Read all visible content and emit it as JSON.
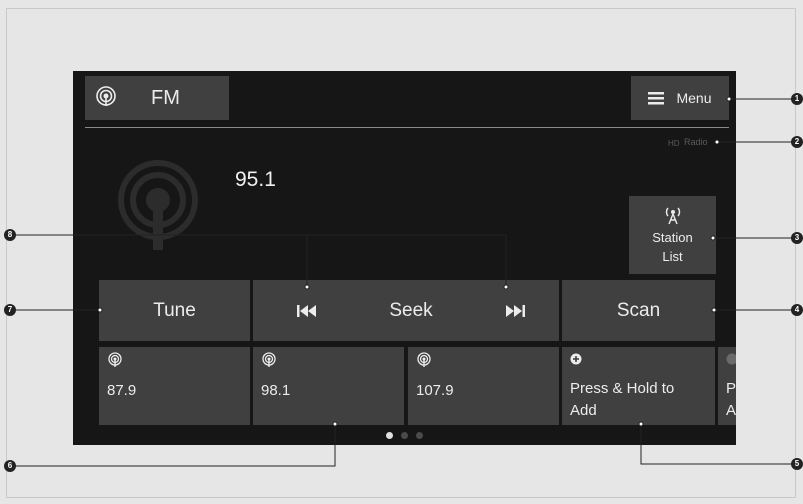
{
  "source": {
    "label": "FM",
    "icon": "radio-icon"
  },
  "menu": {
    "label": "Menu",
    "icon": "hamburger-icon"
  },
  "hd_radio": {
    "label": "Radio"
  },
  "frequency": "95.1",
  "station_list": {
    "label_line1": "Station",
    "label_line2": "List",
    "icon": "antenna-icon"
  },
  "controls": {
    "tune": "Tune",
    "seek": "Seek",
    "scan": "Scan"
  },
  "presets": [
    {
      "label": "87.9"
    },
    {
      "label": "98.1"
    },
    {
      "label": "107.9"
    },
    {
      "label_line1": "Press & Hold to",
      "label_line2": "Add"
    },
    {
      "label_line1": "P",
      "label_line2": "A"
    }
  ],
  "page_indicator": {
    "count": 3,
    "active": 1
  },
  "callouts": [
    "1",
    "2",
    "3",
    "4",
    "5",
    "6",
    "7",
    "8"
  ],
  "colors": {
    "screen_bg": "#161616",
    "button_bg": "#404040",
    "text": "#ececec",
    "page_bg": "#e6e6e6"
  }
}
